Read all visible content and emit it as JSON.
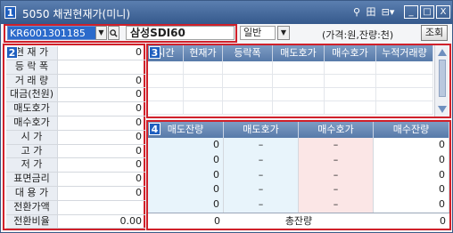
{
  "window": {
    "badge": "1",
    "title": "5050 채권현재가(미니)",
    "pin": "⚲",
    "grid": "田",
    "menu": "⊟▾",
    "min": "_",
    "max": "□",
    "close": "X"
  },
  "toolbar": {
    "code_value": "KR6001301185",
    "name_value": "삼성SDI60",
    "market_select": "일반",
    "unit_label": "(가격:원,잔량:천)",
    "query_button": "조회"
  },
  "panel2": {
    "badge": "2",
    "rows": [
      {
        "label": "현 재 가",
        "value": "0"
      },
      {
        "label": "등 락 폭",
        "value": ""
      },
      {
        "label": "거 래 량",
        "value": "0"
      },
      {
        "label": "대금(천원)",
        "value": "0"
      },
      {
        "label": "매도호가",
        "value": "0"
      },
      {
        "label": "매수호가",
        "value": "0"
      },
      {
        "label": "시    가",
        "value": "0"
      },
      {
        "label": "고    가",
        "value": "0"
      },
      {
        "label": "저    가",
        "value": "0"
      },
      {
        "label": "표면금리",
        "value": "0"
      },
      {
        "label": "대 용 가",
        "value": "0"
      },
      {
        "label": "전환가액",
        "value": ""
      },
      {
        "label": "전환비율",
        "value": "0.00"
      }
    ]
  },
  "panel3": {
    "badge": "3",
    "columns": [
      "시간",
      "현재가",
      "등락폭",
      "매도호가",
      "매수호가",
      "누적거래량"
    ]
  },
  "panel4": {
    "badge": "4",
    "columns": [
      "매도잔량",
      "매도호가",
      "매수호가",
      "매수잔량"
    ],
    "rows": [
      {
        "sell_qty": "0",
        "sell_price": "–",
        "buy_price": "–",
        "buy_qty": "0"
      },
      {
        "sell_qty": "0",
        "sell_price": "–",
        "buy_price": "–",
        "buy_qty": "0"
      },
      {
        "sell_qty": "0",
        "sell_price": "–",
        "buy_price": "–",
        "buy_qty": "0"
      },
      {
        "sell_qty": "0",
        "sell_price": "–",
        "buy_price": "–",
        "buy_qty": "0"
      },
      {
        "sell_qty": "0",
        "sell_price": "–",
        "buy_price": "–",
        "buy_qty": "0"
      }
    ],
    "total_sell": "0",
    "total_label": "총잔량",
    "total_buy": "0"
  },
  "colors": {
    "accent": "#d0202a",
    "header": "#577aa9",
    "sell_bg": "#e8f4fb",
    "buy_bg": "#fbe6e6"
  }
}
